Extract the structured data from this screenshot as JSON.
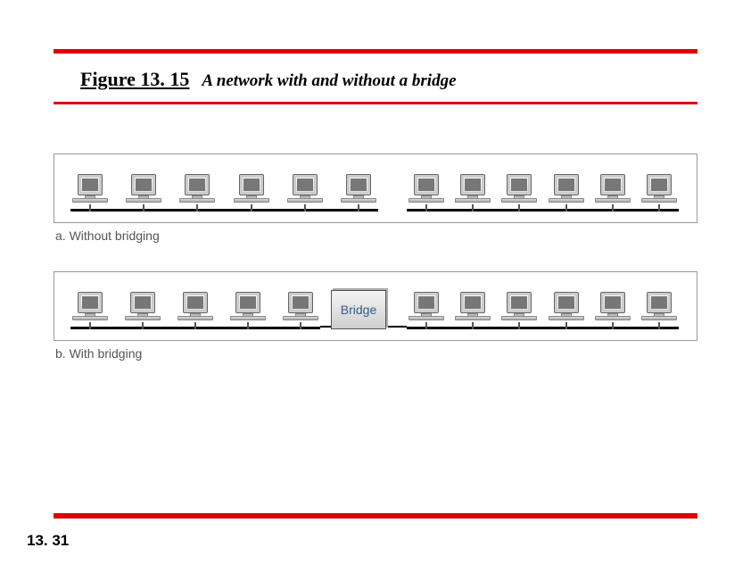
{
  "figure": {
    "number": "Figure 13. 15",
    "caption": "A network with and without a bridge"
  },
  "panel_a": {
    "caption": "a. Without bridging",
    "group1_count": 6,
    "group2_count": 6
  },
  "panel_b": {
    "caption": "b. With bridging",
    "group1_count": 5,
    "group2_count": 6,
    "bridge_label": "Bridge"
  },
  "page_number": "13. 31"
}
